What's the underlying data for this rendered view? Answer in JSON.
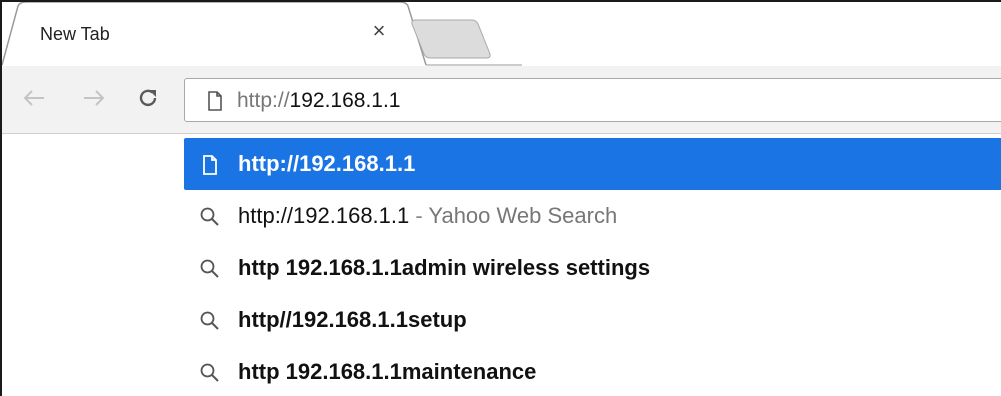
{
  "tab": {
    "title": "New Tab",
    "close_glyph": "×"
  },
  "toolbar": {
    "back_icon": "back-arrow-icon",
    "forward_icon": "forward-arrow-icon",
    "reload_icon": "reload-icon"
  },
  "omnibox": {
    "scheme": "http://",
    "host": "192.168.1.1"
  },
  "suggestions": [
    {
      "icon": "page-icon",
      "text": "http://192.168.1.1",
      "selected": true
    },
    {
      "icon": "search-icon",
      "text": "http://192.168.1.1",
      "separator": " - ",
      "description": "Yahoo Web Search"
    },
    {
      "icon": "search-icon",
      "text": "http 192.168.1.1admin wireless settings"
    },
    {
      "icon": "search-icon",
      "text": "http//192.168.1.1setup"
    },
    {
      "icon": "search-icon",
      "text": "http 192.168.1.1maintenance"
    }
  ],
  "colors": {
    "selected_row": "#1b74e4",
    "toolbar_bg": "#f2f2f2"
  }
}
